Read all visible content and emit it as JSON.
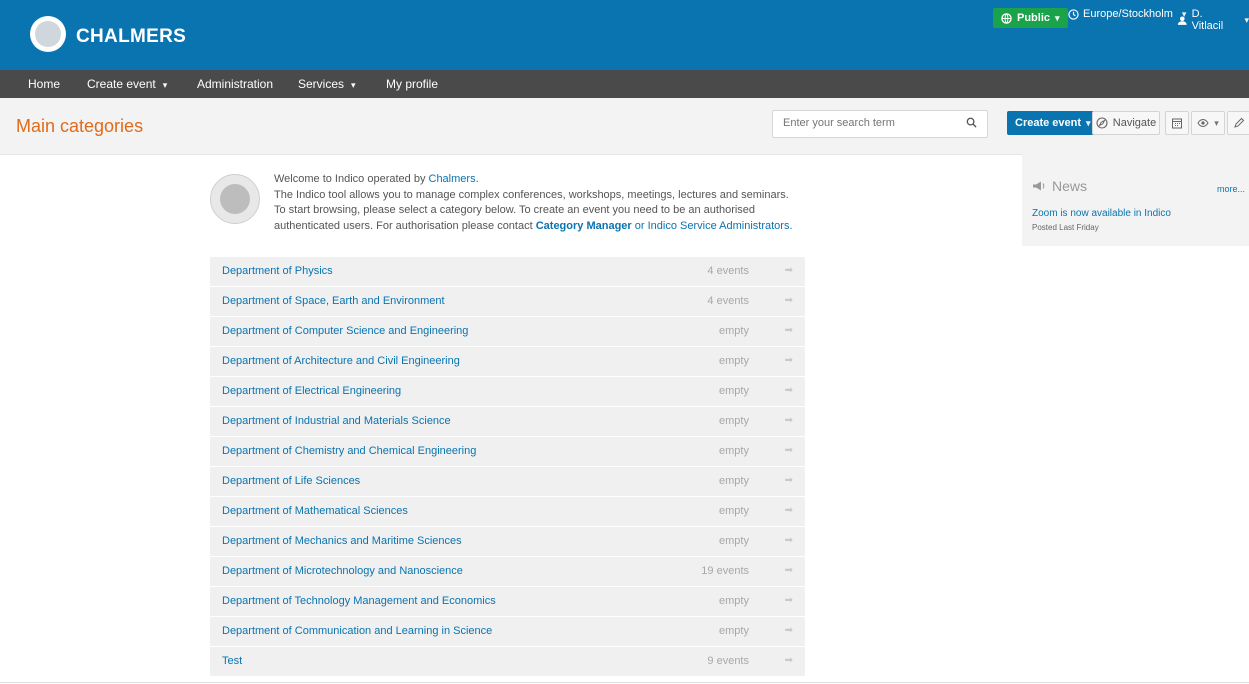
{
  "brand": {
    "name": "CHALMERS"
  },
  "topbar": {
    "public_label": "Public",
    "timezone_label": "Europe/Stockholm",
    "user_label": "D. Vitlacil"
  },
  "nav": {
    "items": [
      {
        "label": "Home"
      },
      {
        "label": "Create event"
      },
      {
        "label": "Administration"
      },
      {
        "label": "Services"
      },
      {
        "label": "My profile"
      }
    ]
  },
  "page": {
    "title": "Main categories",
    "search_placeholder": "Enter your search term",
    "create_event_label": "Create event",
    "navigate_label": "Navigate"
  },
  "welcome": {
    "line1_prefix": "Welcome to Indico operated by ",
    "line1_link": "Chalmers",
    "line1_suffix": ".",
    "line2": "The Indico tool allows you to manage complex conferences, workshops, meetings, lectures and seminars.",
    "line3": "To start browsing, please select a category below. To create an event you need to be an authorised",
    "line4_prefix": "authenticated users. For authorisation please contact ",
    "line4_bold": "Category Manager",
    "line4_mid": " or ",
    "line4_link": "Indico Service Administrators",
    "line4_suffix": "."
  },
  "categories": [
    {
      "name": "Department of Physics",
      "count": "4 events"
    },
    {
      "name": "Department of Space, Earth and Environment",
      "count": "4 events"
    },
    {
      "name": "Department of Computer Science and Engineering",
      "count": "empty"
    },
    {
      "name": "Department of Architecture and Civil Engineering",
      "count": "empty"
    },
    {
      "name": "Department of Electrical Engineering",
      "count": "empty"
    },
    {
      "name": "Department of Industrial and Materials Science",
      "count": "empty"
    },
    {
      "name": "Department of Chemistry and Chemical Engineering",
      "count": "empty"
    },
    {
      "name": "Department of Life Sciences",
      "count": "empty"
    },
    {
      "name": "Department of Mathematical Sciences",
      "count": "empty"
    },
    {
      "name": "Department of Mechanics and Maritime Sciences",
      "count": "empty"
    },
    {
      "name": "Department of Microtechnology and Nanoscience",
      "count": "19 events"
    },
    {
      "name": "Department of Technology Management and Economics",
      "count": "empty"
    },
    {
      "name": "Department of Communication and Learning in Science",
      "count": "empty"
    },
    {
      "name": "Test",
      "count": "9 events"
    }
  ],
  "news": {
    "title": "News",
    "more_label": "more...",
    "item": "Zoom is now available in Indico",
    "date": "Posted Last Friday"
  },
  "colors": {
    "header": "#0a74b0",
    "nav": "#4a4a4a",
    "accent": "#e06b1a",
    "public": "#1aa34a",
    "link": "#0a74b0"
  }
}
